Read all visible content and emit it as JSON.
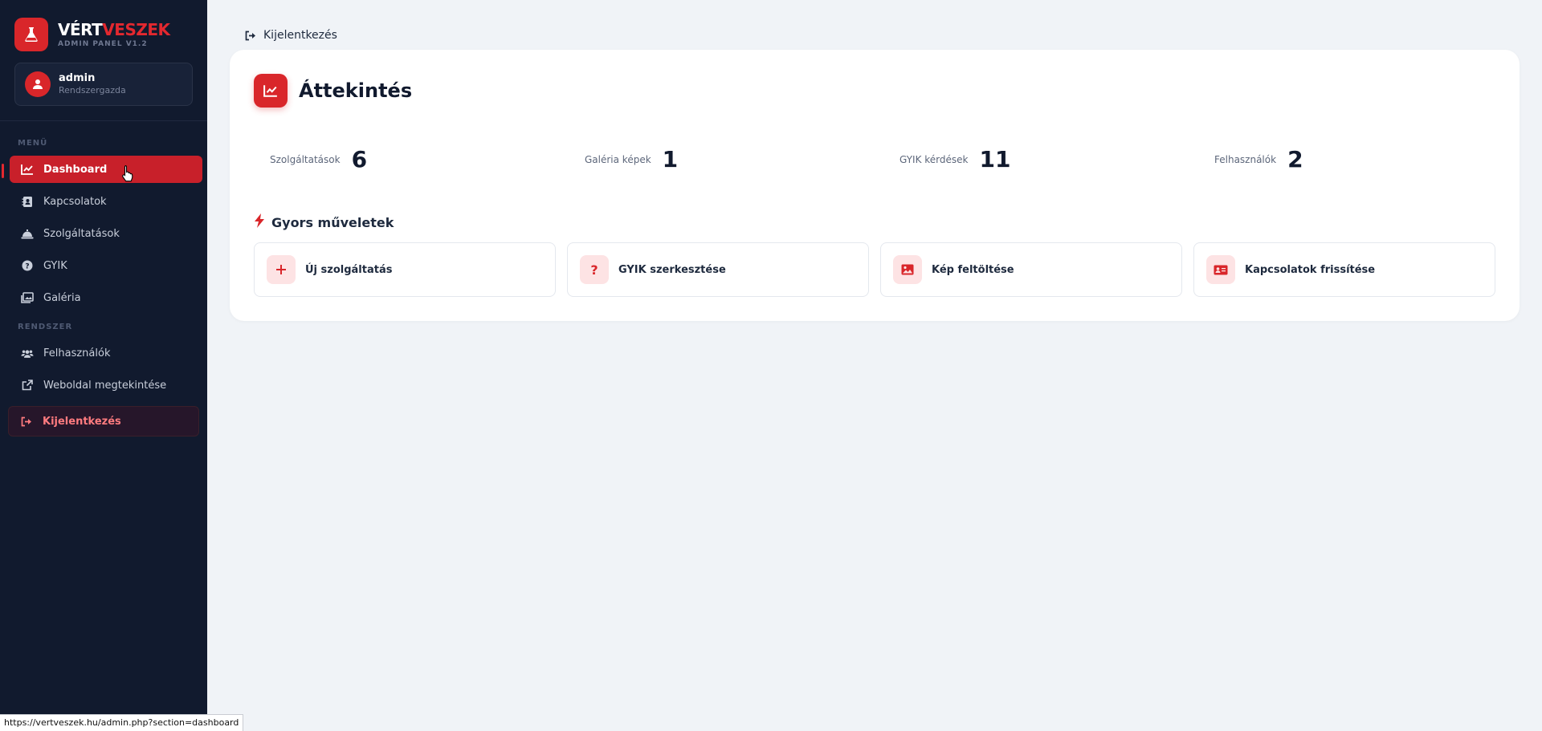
{
  "brand": {
    "name_white": "VÉRT",
    "name_red": "VESZEK",
    "subtitle": "ADMIN PANEL V1.2"
  },
  "user": {
    "name": "admin",
    "role": "Rendszergazda"
  },
  "sidebar": {
    "menu_label": "MENÜ",
    "system_label": "RENDSZER",
    "items": [
      {
        "label": "Dashboard",
        "icon": "chart-line-icon",
        "active": true
      },
      {
        "label": "Kapcsolatok",
        "icon": "address-book-icon"
      },
      {
        "label": "Szolgáltatások",
        "icon": "concierge-bell-icon"
      },
      {
        "label": "GYIK",
        "icon": "question-circle-icon"
      },
      {
        "label": "Galéria",
        "icon": "images-icon"
      }
    ],
    "system_items": [
      {
        "label": "Felhasználók",
        "icon": "users-icon"
      },
      {
        "label": "Weboldal megtekintése",
        "icon": "external-link-icon"
      }
    ],
    "logout_label": "Kijelentkezés"
  },
  "topbar": {
    "logout_label": "Kijelentkezés"
  },
  "main": {
    "title": "Áttekintés",
    "stats": [
      {
        "label": "Szolgáltatások",
        "value": "6"
      },
      {
        "label": "Galéria képek",
        "value": "1"
      },
      {
        "label": "GYIK kérdések",
        "value": "11"
      },
      {
        "label": "Felhasználók",
        "value": "2"
      }
    ],
    "quick_actions_title": "Gyors műveletek",
    "quick_actions": [
      {
        "label": "Új szolgáltatás",
        "icon": "plus-icon"
      },
      {
        "label": "GYIK szerkesztése",
        "icon": "question-icon"
      },
      {
        "label": "Kép feltöltése",
        "icon": "image-icon"
      },
      {
        "label": "Kapcsolatok frissítése",
        "icon": "id-card-icon"
      }
    ]
  },
  "statusbar": {
    "url": "https://vertveszek.hu/admin.php?section=dashboard"
  },
  "colors": {
    "accent": "#d9262a",
    "sidebar_bg": "#111a2e",
    "page_bg": "#f0f3f7"
  }
}
